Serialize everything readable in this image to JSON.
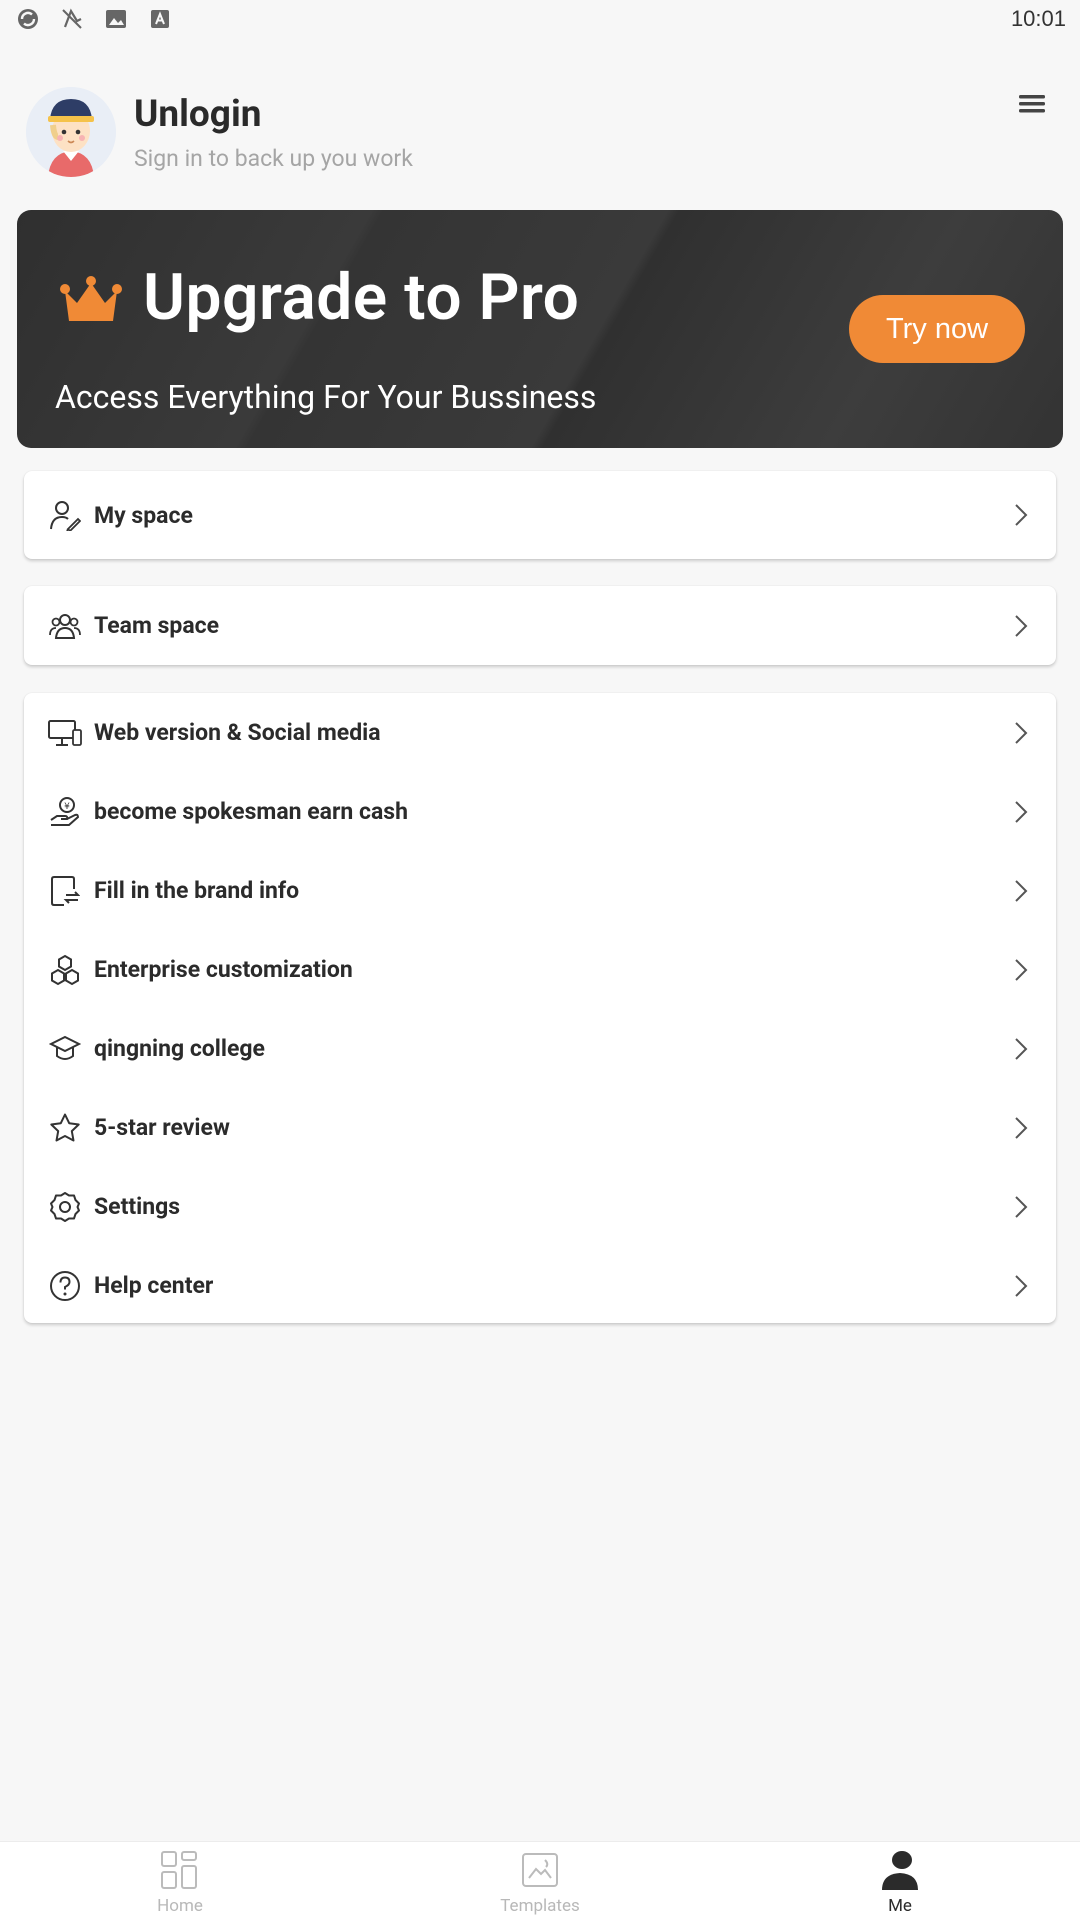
{
  "status_bar": {
    "time": "10:01",
    "icons": [
      "sync-icon",
      "mute-icon",
      "image-icon",
      "text-icon"
    ]
  },
  "profile": {
    "name": "Unlogin",
    "subtitle": "Sign in to back up you work"
  },
  "banner": {
    "title": "Upgrade to Pro",
    "subtitle": "Access Everything For Your Bussiness",
    "button": "Try now",
    "accent": "#f08a36"
  },
  "menu": {
    "my_space": "My space",
    "team_space": "Team space",
    "items": [
      {
        "label": "Web version & Social media",
        "icon": "desktop-icon"
      },
      {
        "label": "become spokesman earn cash",
        "icon": "hand-coin-icon"
      },
      {
        "label": "Fill in the brand info",
        "icon": "brand-form-icon"
      },
      {
        "label": "Enterprise customization",
        "icon": "hexagons-icon"
      },
      {
        "label": "qingning college",
        "icon": "graduation-cap-icon"
      },
      {
        "label": "5-star review",
        "icon": "star-icon"
      },
      {
        "label": "Settings",
        "icon": "gear-icon"
      },
      {
        "label": "Help center",
        "icon": "question-icon"
      }
    ]
  },
  "bottom_nav": {
    "home": "Home",
    "templates": "Templates",
    "me": "Me",
    "active": "Me"
  }
}
